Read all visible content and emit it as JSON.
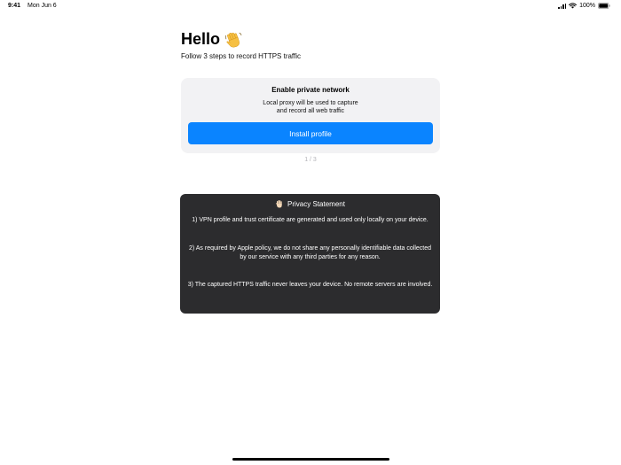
{
  "status_bar": {
    "time": "9:41",
    "date": "Mon Jun 6",
    "battery": "100%",
    "icons": [
      "signal-icon",
      "wifi-icon",
      "battery-icon"
    ]
  },
  "header": {
    "title": "Hello",
    "title_icon": "waving-hand-icon",
    "subtitle": "Follow 3 steps to record HTTPS traffic"
  },
  "step_card": {
    "title": "Enable private network",
    "description_line1": "Local proxy will be used to capture",
    "description_line2": "and record all web traffic",
    "button_label": "Install profile",
    "accent_color": "#0a84ff"
  },
  "pager": {
    "text": "1 / 3",
    "current": 1,
    "total": 3
  },
  "privacy": {
    "icon": "raised-hand-icon",
    "heading": "Privacy Statement",
    "items": [
      "1) VPN profile and trust certificate are generated and used only locally on your device.",
      "2) As required by Apple policy, we do not share any personally identifiable data collected by our service with any third parties for any reason.",
      "3) The captured HTTPS traffic never leaves your device. No remote servers are involved."
    ],
    "background_color": "#2c2c2e"
  }
}
